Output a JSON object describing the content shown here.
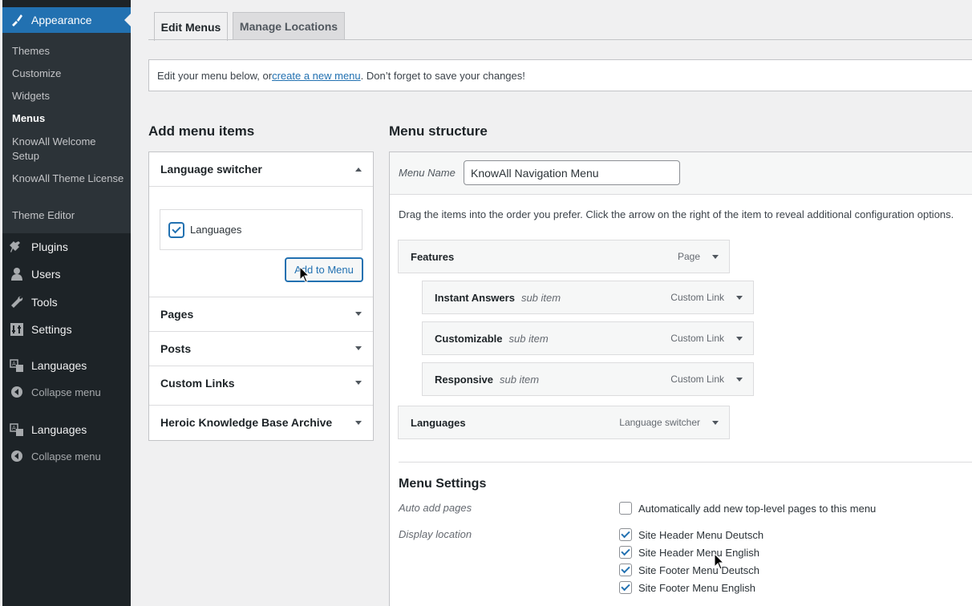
{
  "sidebar": {
    "appearance": "Appearance",
    "submenu": [
      {
        "label": "Themes"
      },
      {
        "label": "Customize"
      },
      {
        "label": "Widgets"
      },
      {
        "label": "Menus"
      },
      {
        "label": "KnowAll Welcome Setup"
      },
      {
        "label": "KnowAll Theme License"
      },
      {
        "label": "Theme Editor"
      }
    ],
    "plugins": "Plugins",
    "users": "Users",
    "tools": "Tools",
    "settings": "Settings",
    "languages_1": "Languages",
    "collapse_1": "Collapse menu",
    "languages_2": "Languages",
    "collapse_2": "Collapse menu"
  },
  "tabs": {
    "edit_menus": "Edit Menus",
    "manage_locations": "Manage Locations"
  },
  "notice": {
    "before": "Edit your menu below, or ",
    "link": "create a new menu",
    "after": ". Don’t forget to save your changes!"
  },
  "add_items": {
    "heading": "Add menu items",
    "language_switcher": "Language switcher",
    "languages_option": "Languages",
    "add_button": "Add to Menu",
    "pages": "Pages",
    "posts": "Posts",
    "custom_links": "Custom Links",
    "archive": "Heroic Knowledge Base Archive"
  },
  "structure": {
    "heading": "Menu structure",
    "name_label": "Menu Name",
    "name_value": "KnowAll Navigation Menu",
    "instructions": "Drag the items into the order you prefer. Click the arrow on the right of the item to reveal additional configuration options.",
    "items": [
      {
        "title": "Features",
        "sub": "",
        "type": "Page"
      },
      {
        "title": "Instant Answers",
        "sub": "sub item",
        "type": "Custom Link"
      },
      {
        "title": "Customizable",
        "sub": "sub item",
        "type": "Custom Link"
      },
      {
        "title": "Responsive",
        "sub": "sub item",
        "type": "Custom Link"
      },
      {
        "title": "Languages",
        "sub": "",
        "type": "Language switcher"
      }
    ]
  },
  "settings": {
    "heading": "Menu Settings",
    "auto_add_label": "Auto add pages",
    "auto_add_text": "Automatically add new top-level pages to this menu",
    "auto_add_checked": false,
    "display_label": "Display location",
    "locations": [
      {
        "label": "Site Header Menu Deutsch",
        "checked": true
      },
      {
        "label": "Site Header Menu English",
        "checked": true
      },
      {
        "label": "Site Footer Menu Deutsch",
        "checked": true
      },
      {
        "label": "Site Footer Menu English",
        "checked": true
      }
    ]
  },
  "colors": {
    "accent": "#2271b1",
    "sidebar_bg": "#1d2327",
    "submenu_bg": "#2c3338"
  }
}
